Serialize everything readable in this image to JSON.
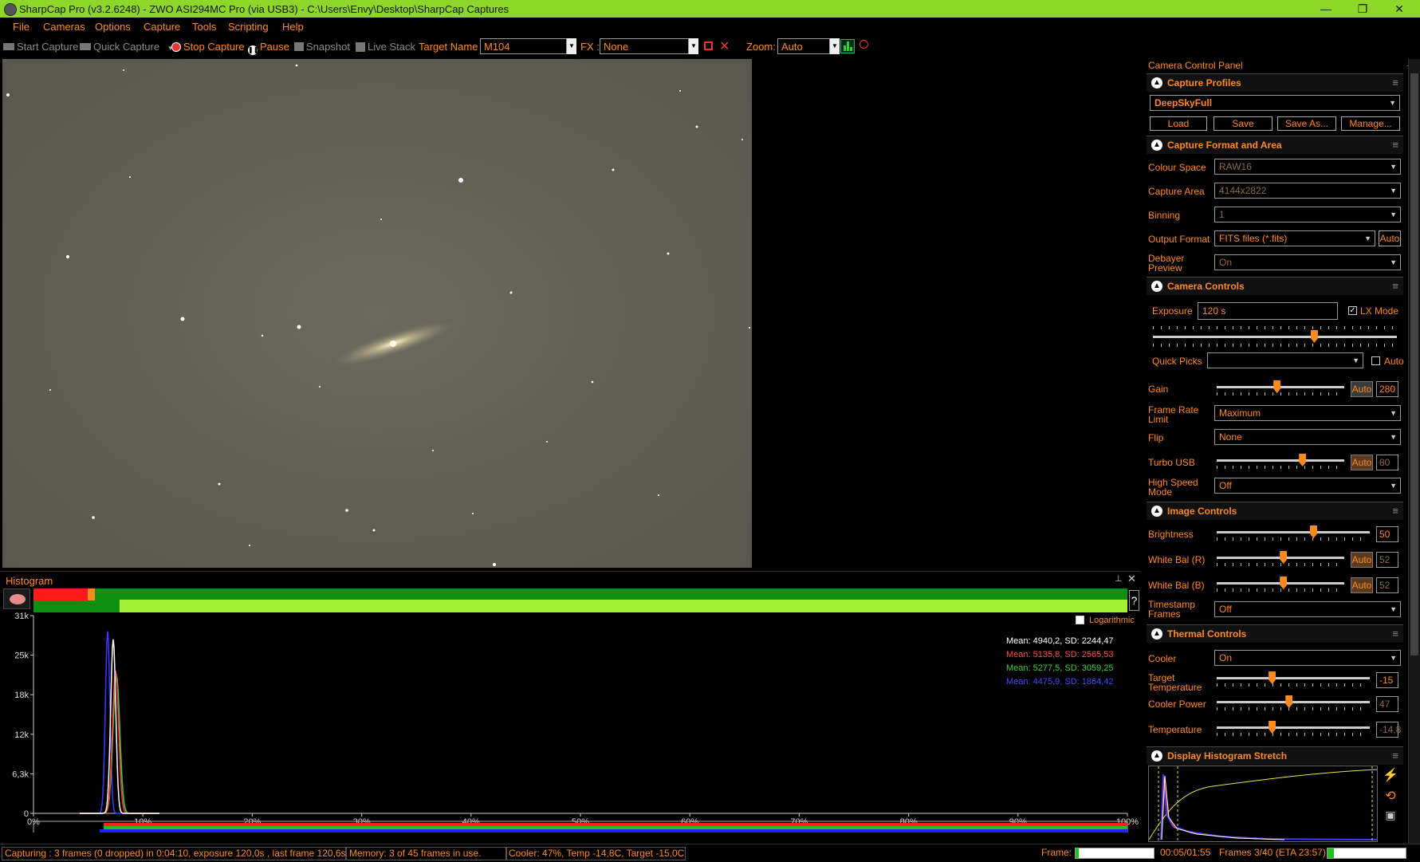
{
  "window": {
    "title": "SharpCap Pro (v3.2.6248) - ZWO ASI294MC Pro (via USB3) - C:\\Users\\Envy\\Desktop\\SharpCap Captures",
    "minimize": "—",
    "maximize": "❐",
    "close": "✕"
  },
  "menu": [
    "File",
    "Cameras",
    "Options",
    "Capture",
    "Tools",
    "Scripting",
    "Help"
  ],
  "toolbar": {
    "start_capture": "Start Capture",
    "quick_capture": "Quick Capture",
    "stop_capture": "Stop Capture",
    "pause": "Pause",
    "snapshot": "Snapshot",
    "live_stack": "Live Stack",
    "target_label": "Target Name :",
    "target_value": "M104",
    "fx_label": "FX :",
    "fx_value": "None",
    "zoom_label": "Zoom:",
    "zoom_value": "Auto"
  },
  "histogram": {
    "title": "Histogram",
    "pin": "📌",
    "close": "✕",
    "help": "?",
    "logarithmic_label": "Logarithmic",
    "y_ticks": [
      "31k",
      "25k",
      "18k",
      "12k",
      "6,3k",
      "0"
    ],
    "x_ticks": [
      "0%",
      "10%",
      "20%",
      "30%",
      "40%",
      "50%",
      "60%",
      "70%",
      "80%",
      "90%",
      "100%"
    ],
    "stats": {
      "white": "Mean: 4940,2, SD: 2244,47",
      "red": "Mean: 5135,8, SD: 2565,53",
      "green": "Mean: 5277,5, SD: 3059,25",
      "blue": "Mean: 4475,9, SD: 1864,42"
    },
    "colors": {
      "white": "#ffffff",
      "red": "#ff3b3b",
      "green": "#3cd23c",
      "blue": "#3b3bff"
    }
  },
  "status": {
    "capturing": "Capturing : 3 frames (0 dropped) in 0:04:10, exposure 120,0s , last frame 120,6s",
    "memory": "Memory: 3 of 45 frames in use.",
    "cooler": "Cooler: 47%, Temp -14,8C, Target -15,0C",
    "frame_label": "Frame:",
    "time": "00:05/01:55",
    "frames": "Frames 3/40 (ETA 23:57)",
    "frame_progress": 0.04
  },
  "ccp": {
    "title": "Camera Control Panel",
    "capture_profiles": {
      "header": "Capture Profiles",
      "profile": "DeepSkyFull",
      "load": "Load",
      "save": "Save",
      "save_as": "Save As...",
      "manage": "Manage..."
    },
    "capture_format": {
      "header": "Capture Format and Area",
      "colour_space_label": "Colour Space",
      "colour_space": "RAW16",
      "capture_area_label": "Capture Area",
      "capture_area": "4144x2822",
      "binning_label": "Binning",
      "binning": "1",
      "output_format_label": "Output Format",
      "output_format": "FITS files (*.fits)",
      "auto": "Auto",
      "debayer_label": "Debayer Preview",
      "debayer": "On"
    },
    "camera_controls": {
      "header": "Camera Controls",
      "exposure_label": "Exposure",
      "exposure": "120 s",
      "lx_mode": "LX Mode",
      "exposure_level": 0.66,
      "quick_picks_label": "Quick Picks",
      "quick_picks_auto": "Auto",
      "gain_label": "Gain",
      "gain_auto": "Auto",
      "gain": "280",
      "gain_level": 0.47,
      "frame_rate_label": "Frame Rate Limit",
      "frame_rate": "Maximum",
      "flip_label": "Flip",
      "flip": "None",
      "turbo_label": "Turbo USB",
      "turbo_auto": "Auto",
      "turbo": "80",
      "turbo_level": 0.67,
      "high_speed_label": "High Speed Mode",
      "high_speed": "Off"
    },
    "image_controls": {
      "header": "Image Controls",
      "brightness_label": "Brightness",
      "brightness": "50",
      "brightness_level": 0.63,
      "wb_r_label": "White Bal (R)",
      "wb_r_auto": "Auto",
      "wb_r": "52",
      "wb_r_level": 0.52,
      "wb_b_label": "White Bal (B)",
      "wb_b_auto": "Auto",
      "wb_b": "52",
      "wb_b_level": 0.52,
      "timestamp_label": "Timestamp Frames",
      "timestamp": "Off"
    },
    "thermal_controls": {
      "header": "Thermal Controls",
      "cooler_label": "Cooler",
      "cooler": "On",
      "target_temp_label": "Target Temperature",
      "target_temp": "-15",
      "target_temp_level": 0.36,
      "cooler_power_label": "Cooler Power",
      "cooler_power": "47",
      "cooler_power_level": 0.47,
      "temperature_label": "Temperature",
      "temperature": "-14,8",
      "temperature_level": 0.36
    },
    "display_stretch": {
      "header": "Display Histogram Stretch"
    }
  }
}
